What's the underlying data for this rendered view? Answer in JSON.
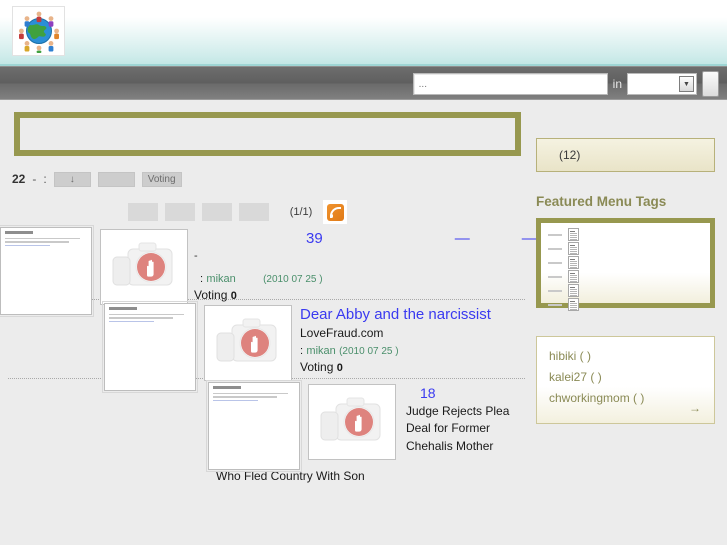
{
  "header": {
    "logo_icon": "globe-people-logo"
  },
  "search": {
    "placeholder": "...",
    "value": "",
    "in_label": "in",
    "scope_value": "",
    "submit_label": "",
    "dropdown_icon": "chevron-down-icon"
  },
  "toolbar": {
    "count": "22",
    "dash": "-",
    "colon": ":",
    "sort_desc_label": "↓",
    "sort_alt_label": "",
    "voting_label": "Voting"
  },
  "pager": {
    "buttons": [
      "",
      "",
      "",
      ""
    ],
    "page_info": "(1/1)",
    "rss_icon": "rss-feed-icon"
  },
  "items": [
    {
      "title": "39",
      "dash1": "—",
      "dash2": "—",
      "sub_dash": "-",
      "source": "",
      "by_label": ":",
      "user": "mikan",
      "date": "(2010 07 25 )",
      "vote_label": "Voting",
      "vote_count": "0",
      "description": "",
      "shot_icon": "page-screenshot-thumbnail",
      "blocked_icon": "blocked-image-camera-icon"
    },
    {
      "title": "Dear Abby and the narcissist",
      "source": "LoveFraud.com",
      "by_label": ":",
      "user": "mikan",
      "date": "(2010 07 25 )",
      "vote_label": "Voting",
      "vote_count": "0",
      "description": "",
      "shot_icon": "page-screenshot-thumbnail",
      "blocked_icon": "blocked-image-camera-icon"
    },
    {
      "title": "18",
      "description": "Judge Rejects Plea Deal for Former Chehalis Mother",
      "description_tail": "Who Fled Country With Son",
      "shot_icon": "page-screenshot-thumbnail",
      "blocked_icon": "blocked-image-camera-icon"
    }
  ],
  "sidebar": {
    "count_label": "(12)",
    "featured_heading": "Featured Menu Tags",
    "tag_rows": [
      "",
      "",
      "",
      "",
      "",
      ""
    ],
    "users": [
      "hibiki (   )",
      "kalei27 (   )",
      "chworkingmom (   )"
    ],
    "more_label": "→"
  },
  "colors": {
    "olive": "#97984f",
    "link_blue": "#3a3af0",
    "user_green": "#4a8f6b",
    "sidebar_olive_text": "#8a8a55",
    "rss_orange": "#e88a20"
  }
}
